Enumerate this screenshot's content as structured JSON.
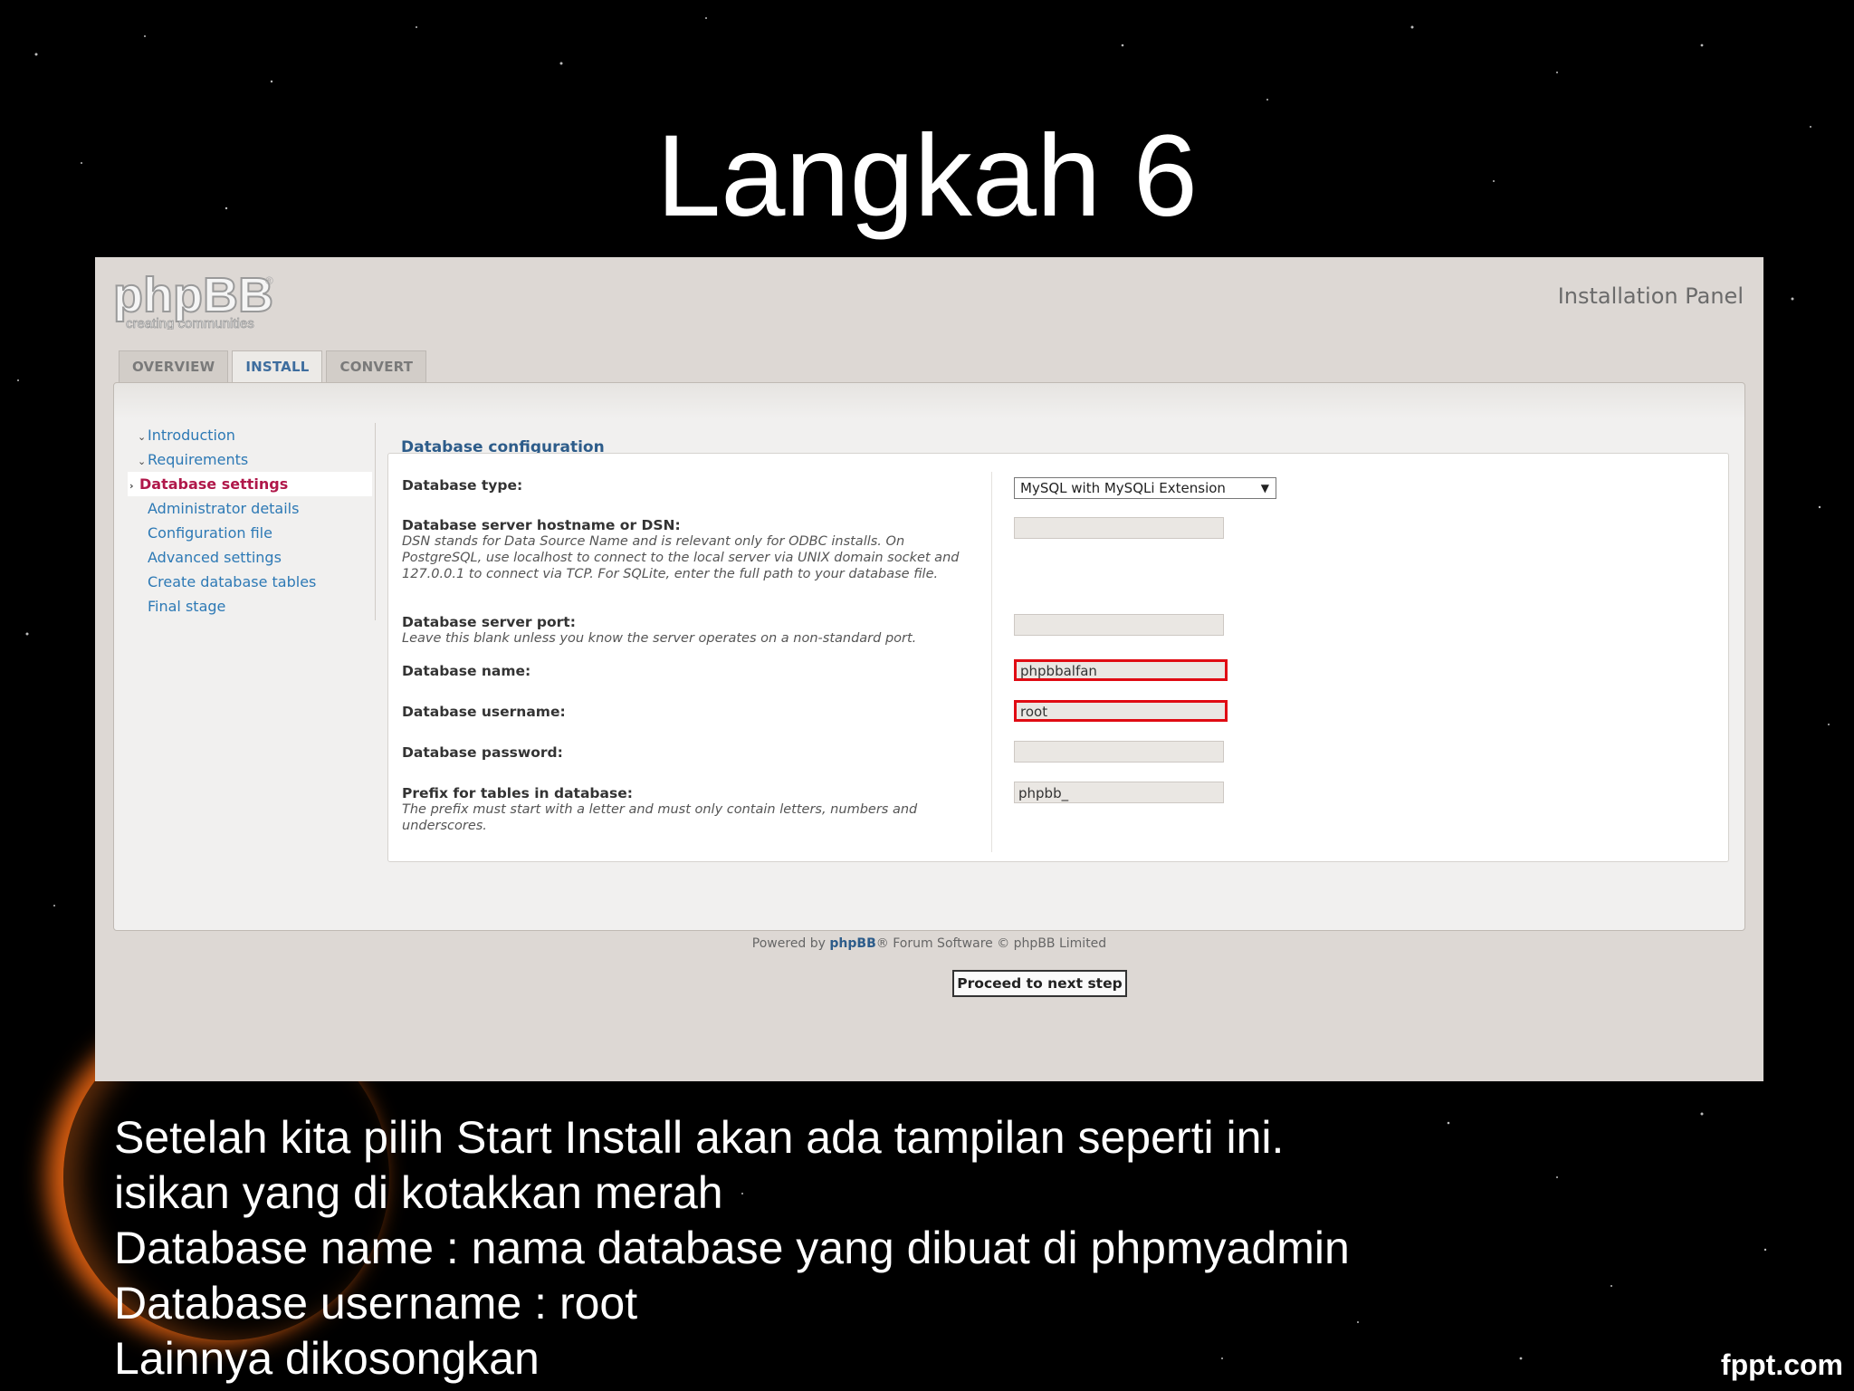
{
  "slide": {
    "title": "Langkah 6",
    "caption_lines": [
      "Setelah kita pilih Start Install akan ada tampilan seperti ini.",
      "isikan yang di kotakkan merah",
      "Database name : nama database yang dibuat di phpmyadmin",
      "Database username : root",
      "Lainnya dikosongkan"
    ],
    "watermark": "fppt.com"
  },
  "app": {
    "logo_text": "phpBB",
    "logo_tagline": "creating communities",
    "panel_title": "Installation Panel",
    "tabs": [
      {
        "label": "OVERVIEW",
        "active": false
      },
      {
        "label": "INSTALL",
        "active": true
      },
      {
        "label": "CONVERT",
        "active": false
      }
    ],
    "menu": [
      {
        "label": "Introduction",
        "state": "done"
      },
      {
        "label": "Requirements",
        "state": "done"
      },
      {
        "label": "Database settings",
        "state": "active"
      },
      {
        "label": "Administrator details",
        "state": "pending"
      },
      {
        "label": "Configuration file",
        "state": "pending"
      },
      {
        "label": "Advanced settings",
        "state": "pending"
      },
      {
        "label": "Create database tables",
        "state": "pending"
      },
      {
        "label": "Final stage",
        "state": "pending"
      }
    ],
    "form": {
      "legend": "Database configuration",
      "db_type": {
        "label": "Database type:",
        "value": "MySQL with MySQLi Extension"
      },
      "db_host": {
        "label": "Database server hostname or DSN:",
        "hint": "DSN stands for Data Source Name and is relevant only for ODBC installs. On PostgreSQL, use localhost to connect to the local server via UNIX domain socket and 127.0.0.1 to connect via TCP. For SQLite, enter the full path to your database file.",
        "value": ""
      },
      "db_port": {
        "label": "Database server port:",
        "hint": "Leave this blank unless you know the server operates on a non-standard port.",
        "value": ""
      },
      "db_name": {
        "label": "Database name:",
        "value": "phpbbalfan"
      },
      "db_user": {
        "label": "Database username:",
        "value": "root"
      },
      "db_pass": {
        "label": "Database password:",
        "value": ""
      },
      "db_prefix": {
        "label": "Prefix for tables in database:",
        "hint": "The prefix must start with a letter and must only contain letters, numbers and underscores.",
        "value": "phpbb_"
      },
      "highlight_color": "#e00b13"
    },
    "submit_label": "Proceed to next step",
    "footer": {
      "prefix": "Powered by",
      "brand": "phpBB",
      "suffix": "® Forum Software © phpBB Limited"
    }
  }
}
